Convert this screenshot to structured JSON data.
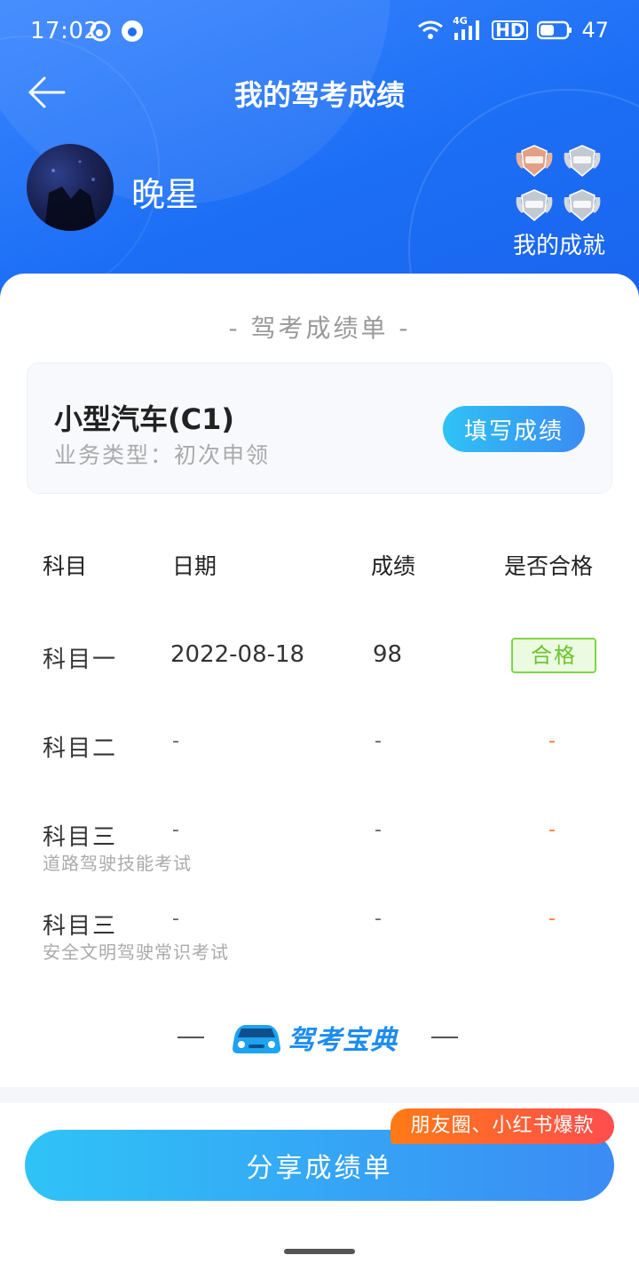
{
  "status_bar": {
    "time": "17:02",
    "network_label": "4G",
    "hd_label": "HD",
    "battery": "47"
  },
  "header": {
    "title": "我的驾考成绩",
    "username": "晚星",
    "achievement_label": "我的成就",
    "medal_text": "通过"
  },
  "card": {
    "heading": "- 驾考成绩单 -",
    "license": {
      "title": "小型汽车(C1)",
      "subtitle": "业务类型：初次申领",
      "fill_button": "填写成绩"
    },
    "table": {
      "headers": [
        "科目",
        "日期",
        "成绩",
        "是否合格"
      ],
      "rows": [
        {
          "subject": "科目一",
          "desc": "",
          "date": "2022-08-18",
          "score": "98",
          "pass": "合格"
        },
        {
          "subject": "科目二",
          "desc": "",
          "date": "-",
          "score": "-",
          "pass": "-"
        },
        {
          "subject": "科目三",
          "desc": "道路驾驶技能考试",
          "date": "-",
          "score": "-",
          "pass": "-"
        },
        {
          "subject": "科目三",
          "desc": "安全文明驾驶常识考试",
          "date": "-",
          "score": "-",
          "pass": "-"
        }
      ]
    },
    "brand": "驾考宝典"
  },
  "bottom": {
    "share_button": "分享成绩单",
    "promo_badge": "朋友圈、小红书爆款"
  },
  "colors": {
    "header_blue": "#1c6ef5",
    "pass_green": "#6cc52e",
    "dash_orange": "#ff7a2e",
    "button_gradient_start": "#2fc3f7",
    "button_gradient_end": "#3b8bf4"
  }
}
